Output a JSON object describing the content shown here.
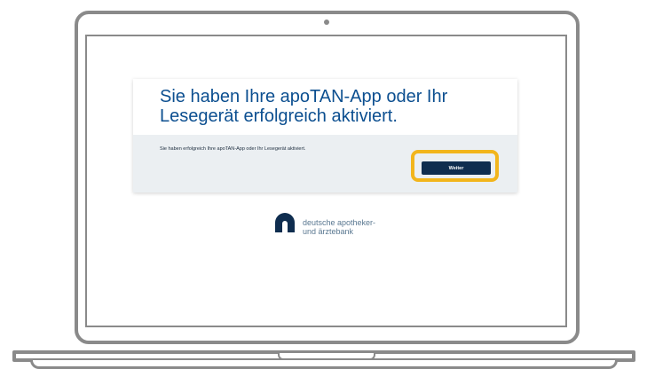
{
  "card": {
    "title": "Sie haben Ihre apoTAN-App oder Ihr Lesegerät erfolgreich aktiviert.",
    "message": "Sie haben erfolgreich Ihre apoTAN-App oder Ihr Lesegerät aktiviert.",
    "button_label": "Weiter"
  },
  "logo": {
    "line1": "deutsche apotheker-",
    "line2": "und ärztebank",
    "icon": "apobank-logo-icon"
  },
  "colors": {
    "title": "#0c4f90",
    "button": "#0f2d4f",
    "highlight": "#f2b51c",
    "panel": "#ebeff2",
    "frame": "#8a8a8a"
  }
}
